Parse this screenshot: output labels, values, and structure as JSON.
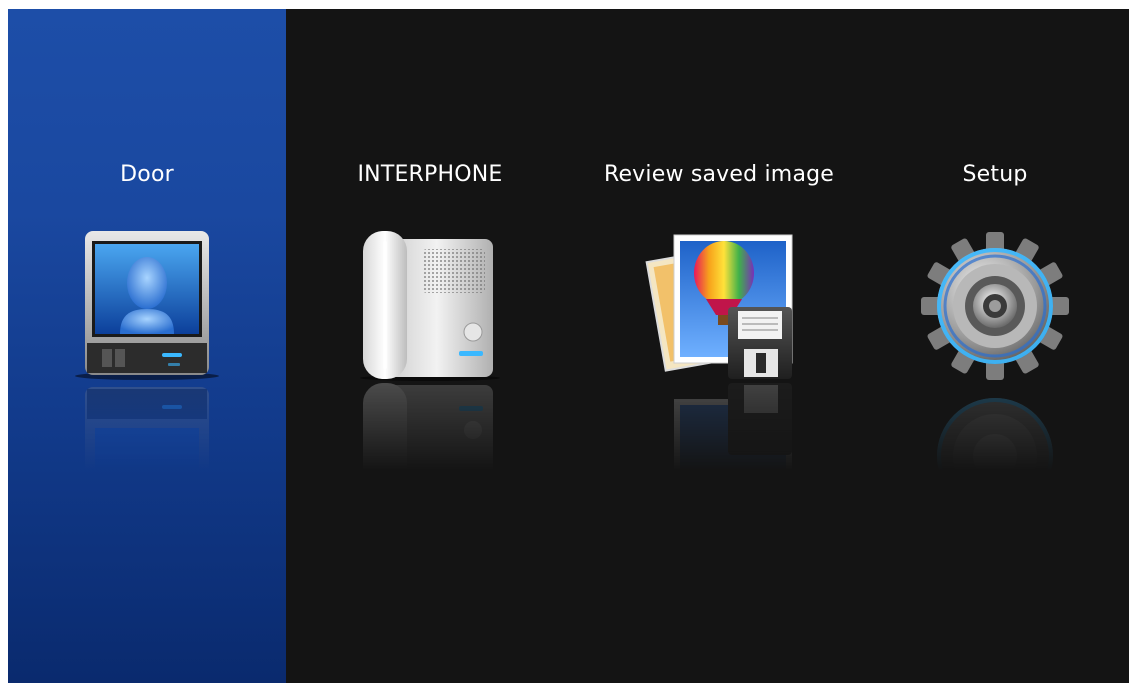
{
  "menu": {
    "items": [
      {
        "label": "Door",
        "icon": "door-monitor-icon",
        "selected": true
      },
      {
        "label": "INTERPHONE",
        "icon": "interphone-icon",
        "selected": false
      },
      {
        "label": "Review saved image",
        "icon": "saved-image-icon",
        "selected": false
      },
      {
        "label": "Setup",
        "icon": "gear-icon",
        "selected": false
      }
    ]
  },
  "colors": {
    "selected_background": "#1a48a0",
    "screen_background": "#141414",
    "label_text": "#ffffff",
    "accent_glow": "#3ab8ff"
  }
}
